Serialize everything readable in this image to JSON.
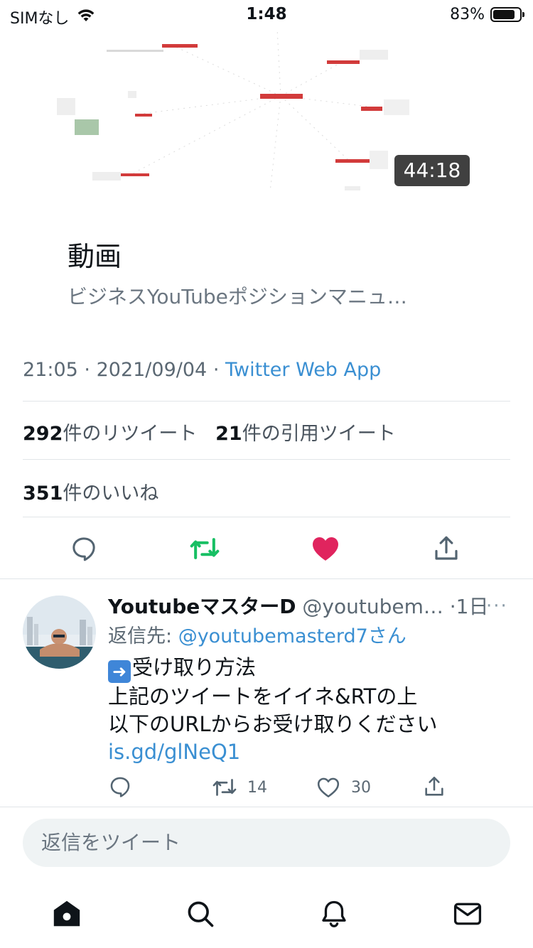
{
  "status_bar": {
    "carrier": "SIMなし",
    "time": "1:48",
    "battery_percent": "83%",
    "battery_level": 0.83
  },
  "video_card": {
    "duration": "44:18",
    "title": "動画",
    "description": "ビジネスYouTubeポジションマニュ…"
  },
  "tweet_meta": {
    "time": "21:05",
    "date": "2021/09/04",
    "separator": "·",
    "source": "Twitter Web App"
  },
  "stats": {
    "retweets_count": "292",
    "retweets_label": "件のリツイート",
    "quotes_count": "21",
    "quotes_label": "件の引用ツイート",
    "likes_count": "351",
    "likes_label": "件のいいね"
  },
  "actions": {
    "reply_icon": "reply-icon",
    "retweet_icon": "retweet-icon",
    "like_icon": "heart-filled-icon",
    "share_icon": "share-icon",
    "retweet_color": "#17bf63",
    "like_color": "#e0245e"
  },
  "reply": {
    "name": "YoutubeマスターD",
    "handle": "@youtubem…",
    "time": "·1日",
    "more": "···",
    "reply_to_prefix": "返信先: ",
    "reply_to_mention": "@youtubemasterd7さん",
    "lines": [
      "受け取り方法",
      "上記のツイートをイイネ&RTの上",
      "以下のURLからお受け取りください"
    ],
    "link": "is.gd/glNeQ1",
    "retweet_count": "14",
    "like_count": "30"
  },
  "compose": {
    "placeholder": "返信をツイート"
  },
  "colors": {
    "link_blue": "#3a8fd2",
    "text_primary": "#0f1419",
    "text_secondary": "#5b6873"
  }
}
